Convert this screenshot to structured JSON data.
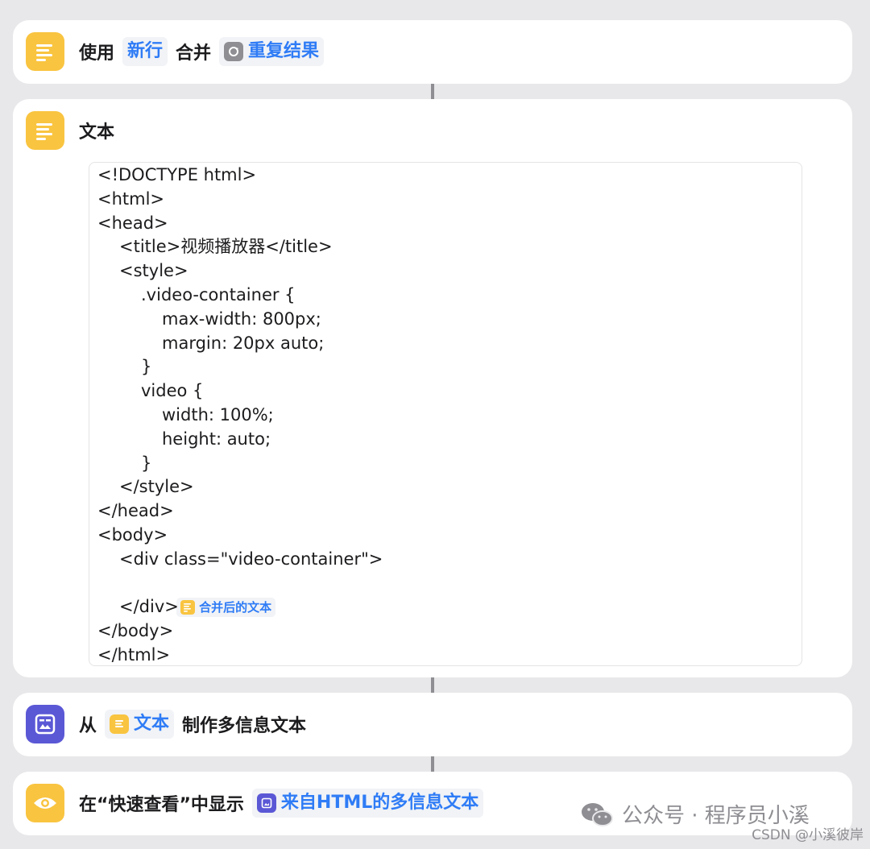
{
  "actions": [
    {
      "id": "combine",
      "parts": {
        "verb": "使用",
        "token1": "新行",
        "middle": "合并",
        "token2": "重复结果"
      }
    },
    {
      "id": "text",
      "title": "文本"
    },
    {
      "id": "make-rich-text",
      "parts": {
        "verb": "从",
        "token1": "文本",
        "suffix": "制作多信息文本"
      }
    },
    {
      "id": "quick-look",
      "parts": {
        "prefix": "在“快速查看”中显示",
        "token1": "来自HTML的多信息文本"
      }
    }
  ],
  "code": {
    "lines": [
      "<!DOCTYPE html>",
      "<html>",
      "<head>",
      "<title>视频播放器</title>",
      "<style>",
      ".video-container {",
      "max-width: 800px;",
      "margin: 20px auto;",
      "}",
      "video {",
      "width: 100%;",
      "height: auto;",
      "}",
      "</style>",
      "</head>",
      "<body>",
      "<div class=\"video-container\">",
      "</div>",
      "</body>",
      "</html>"
    ],
    "variable": "合并后的文本"
  },
  "watermark": {
    "main": "公众号 · 程序员小溪",
    "sub": "CSDN @小溪彼岸"
  },
  "colors": {
    "background": "#e8e8ea",
    "card": "#ffffff",
    "accent_blue": "#2f7cf6",
    "icon_yellow": "#f9c440",
    "icon_purple": "#5b58d6",
    "icon_gray": "#8e8e93"
  },
  "icons": {
    "text_action": "text-lines-icon",
    "repeat_result": "repeat-icon",
    "rich_text": "rich-text-icon",
    "quick_look": "eye-icon",
    "watermark": "wechat-icon"
  }
}
